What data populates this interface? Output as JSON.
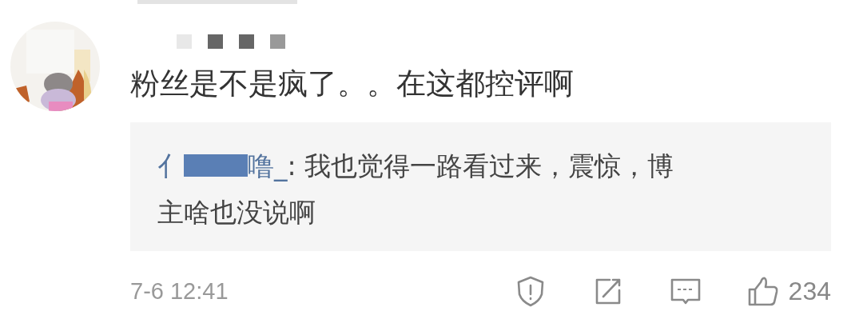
{
  "comment": {
    "kind": "picture",
    "text": "粉丝是不是疯了。。在这都控评啊",
    "reply": {
      "author_start": "亻",
      "author_end": "噜_",
      "text_lines": [
        ": 我也觉得一路看过来，震惊，博",
        "主啥也没说啊"
      ]
    },
    "timestamp": "7-6 12:41",
    "like_count": "234"
  }
}
